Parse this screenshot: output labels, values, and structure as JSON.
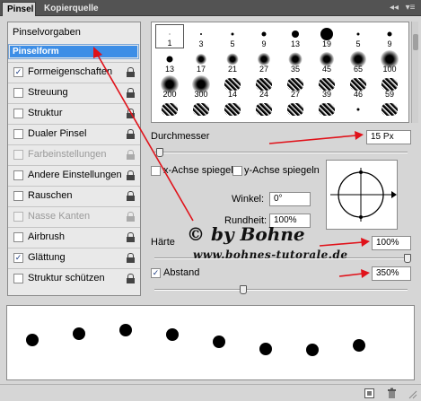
{
  "tabs": [
    {
      "label": "Pinsel"
    },
    {
      "label": "Kopierquelle"
    }
  ],
  "header_controls": {
    "collapse": "◂◂",
    "menu": "▾≡"
  },
  "sidebar": {
    "header": "Pinselvorgaben",
    "selected": "Pinselform",
    "items": [
      {
        "label": "Formeigenschaften",
        "checked": true,
        "lock": true,
        "enabled": true
      },
      {
        "label": "Streuung",
        "checked": false,
        "lock": true,
        "enabled": true
      },
      {
        "label": "Struktur",
        "checked": false,
        "lock": true,
        "enabled": true
      },
      {
        "label": "Dualer Pinsel",
        "checked": false,
        "lock": true,
        "enabled": true
      },
      {
        "label": "Farbeinstellungen",
        "checked": false,
        "lock": true,
        "enabled": false
      },
      {
        "label": "Andere Einstellungen",
        "checked": false,
        "lock": true,
        "enabled": true
      },
      {
        "label": "Rauschen",
        "checked": false,
        "lock": true,
        "enabled": true
      },
      {
        "label": "Nasse Kanten",
        "checked": false,
        "lock": true,
        "enabled": false
      },
      {
        "label": "Airbrush",
        "checked": false,
        "lock": true,
        "enabled": true
      },
      {
        "label": "Glättung",
        "checked": true,
        "lock": true,
        "enabled": true
      },
      {
        "label": "Struktur schützen",
        "checked": false,
        "lock": true,
        "enabled": true
      }
    ]
  },
  "brush_grid": {
    "rows": [
      [
        {
          "n": "1",
          "t": "hard",
          "d": 1
        },
        {
          "n": "3",
          "t": "hard",
          "d": 2
        },
        {
          "n": "5",
          "t": "hard",
          "d": 3
        },
        {
          "n": "9",
          "t": "hard",
          "d": 5
        },
        {
          "n": "13",
          "t": "hard",
          "d": 8
        },
        {
          "n": "19",
          "t": "hard",
          "d": 14
        },
        {
          "n": "5",
          "t": "hard",
          "d": 3
        },
        {
          "n": "9",
          "t": "hard",
          "d": 5
        }
      ],
      [
        {
          "n": "13",
          "t": "hard",
          "d": 7
        },
        {
          "n": "17",
          "t": "soft",
          "d": 12
        },
        {
          "n": "21",
          "t": "soft",
          "d": 13
        },
        {
          "n": "27",
          "t": "soft",
          "d": 14
        },
        {
          "n": "35",
          "t": "soft",
          "d": 15
        },
        {
          "n": "45",
          "t": "soft",
          "d": 16
        },
        {
          "n": "65",
          "t": "soft",
          "d": 18
        },
        {
          "n": "100",
          "t": "soft",
          "d": 20
        }
      ],
      [
        {
          "n": "200",
          "t": "soft",
          "d": 20
        },
        {
          "n": "300",
          "t": "soft",
          "d": 20
        },
        {
          "n": "14",
          "t": "tex",
          "d": 0
        },
        {
          "n": "24",
          "t": "tex",
          "d": 0
        },
        {
          "n": "27",
          "t": "tex",
          "d": 0
        },
        {
          "n": "39",
          "t": "tex",
          "d": 0
        },
        {
          "n": "46",
          "t": "tex",
          "d": 0
        },
        {
          "n": "59",
          "t": "tex",
          "d": 0
        }
      ],
      [
        {
          "n": "",
          "t": "tex",
          "d": 0
        },
        {
          "n": "",
          "t": "tex",
          "d": 0
        },
        {
          "n": "",
          "t": "tex",
          "d": 0
        },
        {
          "n": "",
          "t": "tex",
          "d": 0
        },
        {
          "n": "",
          "t": "tex",
          "d": 0
        },
        {
          "n": "",
          "t": "tex",
          "d": 0
        },
        {
          "n": "",
          "t": "hard",
          "d": 3
        },
        {
          "n": "",
          "t": "tex",
          "d": 0
        }
      ]
    ]
  },
  "durchmesser": {
    "label": "Durchmesser",
    "value": "15 Px"
  },
  "flip_x": {
    "label": "x-Achse spiegeln",
    "checked": false
  },
  "flip_y": {
    "label": "y-Achse spiegeln",
    "checked": false
  },
  "winkel": {
    "label": "Winkel:",
    "value": "0°"
  },
  "rundheit": {
    "label": "Rundheit:",
    "value": "100%"
  },
  "haerte": {
    "label": "Härte",
    "value": "100%",
    "fraction": 1.0
  },
  "abstand": {
    "label": "Abstand",
    "value": "350%",
    "checked": true,
    "fraction": 0.35
  },
  "durchmesser_fraction": 0.02,
  "watermark": {
    "line1": "© by Bohne",
    "line2": "www.bohnes-tutorale.de"
  },
  "accent_color": "#3d8ee6",
  "arrow_color": "#e0121a"
}
